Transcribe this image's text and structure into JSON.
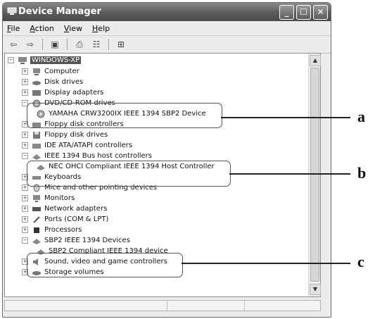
{
  "window": {
    "title": "Device Manager"
  },
  "menu": [
    {
      "label": "File",
      "key": "F",
      "rest": "ile"
    },
    {
      "label": "Action",
      "key": "A",
      "rest": "ction"
    },
    {
      "label": "View",
      "key": "V",
      "rest": "iew"
    },
    {
      "label": "Help",
      "key": "H",
      "rest": "elp"
    }
  ],
  "tree": {
    "root": "WINDOWS-XP",
    "items": [
      {
        "label": "Computer",
        "expanded": false
      },
      {
        "label": "Disk drives",
        "expanded": false
      },
      {
        "label": "Display adapters",
        "expanded": false
      },
      {
        "label": "DVD/CD-ROM drives",
        "expanded": true,
        "children": [
          "YAMAHA CRW3200IX IEEE 1394 SBP2 Device"
        ]
      },
      {
        "label": "Floppy disk controllers",
        "expanded": false
      },
      {
        "label": "Floppy disk drives",
        "expanded": false
      },
      {
        "label": "IDE ATA/ATAPI controllers",
        "expanded": false
      },
      {
        "label": "IEEE 1394 Bus host controllers",
        "expanded": true,
        "children": [
          "NEC OHCI Compliant IEEE 1394 Host Controller"
        ]
      },
      {
        "label": "Keyboards",
        "expanded": false
      },
      {
        "label": "Mice and other pointing devices",
        "expanded": false
      },
      {
        "label": "Monitors",
        "expanded": false
      },
      {
        "label": "Network adapters",
        "expanded": false
      },
      {
        "label": "Ports (COM & LPT)",
        "expanded": false
      },
      {
        "label": "Processors",
        "expanded": false
      },
      {
        "label": "SBP2 IEEE 1394 Devices",
        "expanded": true,
        "children": [
          "SBP2 Compliant IEEE 1394 device"
        ]
      },
      {
        "label": "Sound, video and game controllers",
        "expanded": false
      },
      {
        "label": "Storage volumes",
        "expanded": false
      }
    ]
  },
  "callouts": {
    "a": "a",
    "b": "b",
    "c": "c"
  }
}
